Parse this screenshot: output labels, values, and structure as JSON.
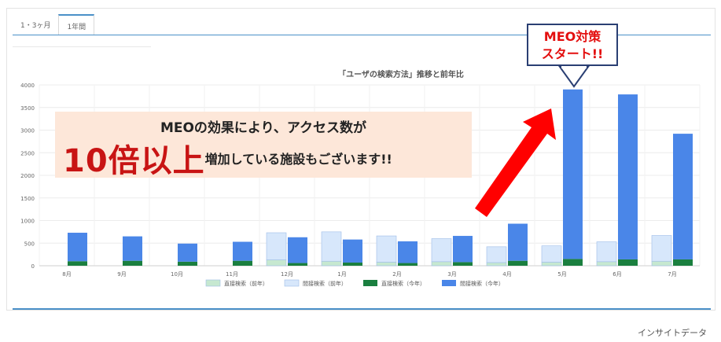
{
  "tabs": [
    {
      "label": "1・3ヶ月"
    },
    {
      "label": "1年間"
    }
  ],
  "chart_data": {
    "type": "bar",
    "title": "「ユーザの検索方法」推移と前年比",
    "categories": [
      "8月",
      "9月",
      "10月",
      "11月",
      "12月",
      "1月",
      "2月",
      "3月",
      "4月",
      "5月",
      "6月",
      "7月"
    ],
    "ylim": [
      0,
      4000
    ],
    "yticks": [
      0,
      500,
      1000,
      1500,
      2000,
      2500,
      3000,
      3500,
      4000
    ],
    "grid": true,
    "legend_position": "bottom",
    "series": [
      {
        "name": "直接検索（前年）",
        "group": "prev",
        "stack_order": 0,
        "color": "#c6e8d0",
        "values": [
          null,
          null,
          null,
          null,
          130,
          100,
          80,
          90,
          70,
          80,
          90,
          100
        ]
      },
      {
        "name": "間接検索（前年）",
        "group": "prev",
        "stack_order": 1,
        "color": "#d7e7fb",
        "values": [
          null,
          null,
          null,
          null,
          600,
          650,
          580,
          510,
          350,
          360,
          440,
          570
        ]
      },
      {
        "name": "直接検索（今年）",
        "group": "curr",
        "stack_order": 0,
        "color": "#1a7f3f",
        "values": [
          100,
          110,
          90,
          110,
          60,
          70,
          60,
          80,
          110,
          150,
          140,
          140
        ]
      },
      {
        "name": "間接検索（今年）",
        "group": "curr",
        "stack_order": 1,
        "color": "#4a86e8",
        "values": [
          630,
          540,
          400,
          420,
          570,
          510,
          480,
          580,
          820,
          3750,
          3650,
          2780
        ]
      }
    ]
  },
  "banner": {
    "line1": "MEOの効果により、アクセス数が",
    "highlight": "10倍以上",
    "line2": "増加している施設もございます!!"
  },
  "callout": {
    "line1": "MEO対策",
    "line2": "スタート!!"
  },
  "caption": "インサイトデータ",
  "colors": {
    "accent": "#4a90c8",
    "arrow": "#ff0000",
    "highlight_text": "#c81414",
    "banner_bg": "#fde7d9",
    "callout_border": "#2a3f73"
  }
}
